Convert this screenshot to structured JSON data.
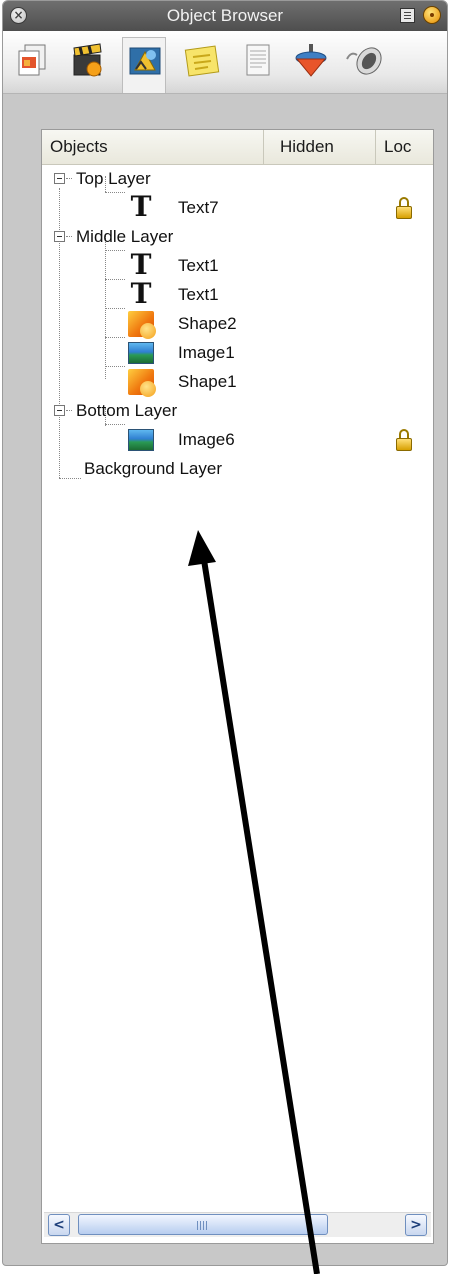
{
  "window": {
    "title": "Object Browser",
    "close_glyph": "×"
  },
  "toolbar": {
    "tools": [
      {
        "icon": "pages-icon"
      },
      {
        "icon": "clapperboard-icon"
      },
      {
        "icon": "objects-icon",
        "active": true
      },
      {
        "icon": "sticky-note-icon"
      },
      {
        "icon": "document-icon"
      },
      {
        "icon": "spinning-top-icon"
      },
      {
        "icon": "mouse-icon"
      }
    ]
  },
  "table": {
    "columns": [
      "Objects",
      "Hidden",
      "Loc"
    ],
    "rows": [
      {
        "label": "Top Layer",
        "type": "layer"
      },
      {
        "label": "Text7",
        "type": "text",
        "locked": true
      },
      {
        "label": "Middle Layer",
        "type": "layer"
      },
      {
        "label": "Text1",
        "type": "text"
      },
      {
        "label": "Text1",
        "type": "text"
      },
      {
        "label": "Shape2",
        "type": "shape"
      },
      {
        "label": "Image1",
        "type": "image"
      },
      {
        "label": "Shape1",
        "type": "shape"
      },
      {
        "label": "Bottom Layer",
        "type": "layer"
      },
      {
        "label": "Image6",
        "type": "image",
        "locked": true
      },
      {
        "label": "Background Layer",
        "type": "layer-leaf"
      }
    ],
    "text_glyph": "T"
  },
  "scrollbar": {
    "left_glyph": "<",
    "right_glyph": ">"
  }
}
